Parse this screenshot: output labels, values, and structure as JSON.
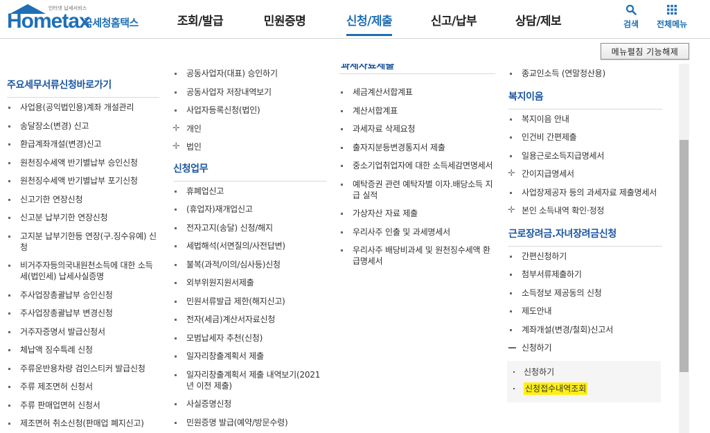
{
  "header": {
    "logo_tagline": "인터넷 납세서비스",
    "logo_text": "Hometax",
    "logo_subtitle": "국세청홈택스",
    "nav": [
      {
        "label": "조회/발급",
        "active": false
      },
      {
        "label": "민원증명",
        "active": false
      },
      {
        "label": "신청/제출",
        "active": true
      },
      {
        "label": "신고/납부",
        "active": false
      },
      {
        "label": "상담/제보",
        "active": false
      }
    ],
    "search_label": "검색",
    "allmenu_label": "전체메뉴",
    "accent_color": "#1f6fb5"
  },
  "menu_toggle_label": "메뉴펼침 기능해제",
  "col1": {
    "title": "주요세무서류신청바로가기",
    "items": [
      "사업용(공익법인용)계좌 개설관리",
      "송달장소(변경) 신고",
      "환급계좌개설(변경)신고",
      "원천징수세액 반기별납부 승인신청",
      "원천징수세액 반기별납부 포기신청",
      "신고기한 연장신청",
      "신고분 납부기한 연장신청",
      "고지분 납부기한등 연장(구.징수유예) 신청",
      "비거주자등의국내원천소득에 대한 소득세(법인세) 납세사실증명",
      "주사업장총괄납부 승인신청",
      "주사업장총괄납부 변경신청",
      "거주자증명서 발급신청서",
      "체납액 징수특례 신청",
      "주류운반용차량 검인스티커 발급신청",
      "주류 제조면허 신청서",
      "주류 판매업면허 신청서",
      "제조면허 취소신청(판매업 폐지신고)"
    ]
  },
  "col2": {
    "top_items": [
      {
        "label": "공동사업자(대표) 승인하기",
        "marker": "bullet"
      },
      {
        "label": "공동사업자 저장내역보기",
        "marker": "bullet"
      },
      {
        "label": "사업자등록신청(법인)",
        "marker": "bullet"
      },
      {
        "label": "개인",
        "marker": "plus"
      },
      {
        "label": "법인",
        "marker": "plus"
      }
    ],
    "title": "신청업무",
    "items": [
      "휴폐업신고",
      "(휴업자)재개업신고",
      "전자고지(송달) 신청/해지",
      "세법해석(서면질의/사전답변)",
      "불복(과적/이의/심사등)신청",
      "외부위원지원서제출",
      "민원서류발급 제한(해지신고)",
      "전자(세금)계산서자료신청",
      "모범납세자 추천(신청)",
      "일자리창출계획서 제출",
      "일자리창출계획서 제출 내역보기(2021년 이전 제출)",
      "사실증명신청",
      "민원증명 발급(예약/방문수령)"
    ]
  },
  "col3": {
    "cut_title": "과세자료제출",
    "items": [
      "세금계산서합계표",
      "계산서합계표",
      "과세자료 삭제요청",
      "출자지분등변경통지서 제출",
      "중소기업취업자에 대한 소득세감면명세서",
      "예탁증권 관련 예탁자별 이자.배당소득 지급 실적",
      "가상자산 자료 제출",
      "우리사주 인출 및 과세명세서",
      "우리사주 배당비과세 및 원천징수세액 환급명세서"
    ]
  },
  "col4": {
    "top_items": [
      "종교인소득 (연말정산용)"
    ],
    "welfare_title": "복지이음",
    "welfare_items": [
      {
        "label": "복지이음 안내",
        "marker": "bullet"
      },
      {
        "label": "인건비 간편제출",
        "marker": "bullet"
      },
      {
        "label": "일용근로소득지급명세서",
        "marker": "bullet"
      },
      {
        "label": "간이지급명세서",
        "marker": "plus"
      },
      {
        "label": "사업장제공자 등의 과세자료 제출명세서",
        "marker": "bullet"
      },
      {
        "label": "본인 소득내역 확인·정정",
        "marker": "plus"
      }
    ],
    "eitc_title": "근로장려금.자녀장려금신청",
    "eitc_items": [
      {
        "label": "간편신청하기",
        "marker": "bullet"
      },
      {
        "label": "첨부서류제출하기",
        "marker": "bullet"
      },
      {
        "label": "소득정보 제공동의 신청",
        "marker": "bullet"
      },
      {
        "label": "제도안내",
        "marker": "bullet"
      },
      {
        "label": "계좌개설(변경/철회)신고서",
        "marker": "bullet"
      },
      {
        "label": "신청하기",
        "marker": "minus"
      }
    ],
    "sub_items": [
      {
        "label": "신청하기",
        "highlighted": false
      },
      {
        "label": "신청접수내역조회",
        "highlighted": true
      }
    ]
  }
}
